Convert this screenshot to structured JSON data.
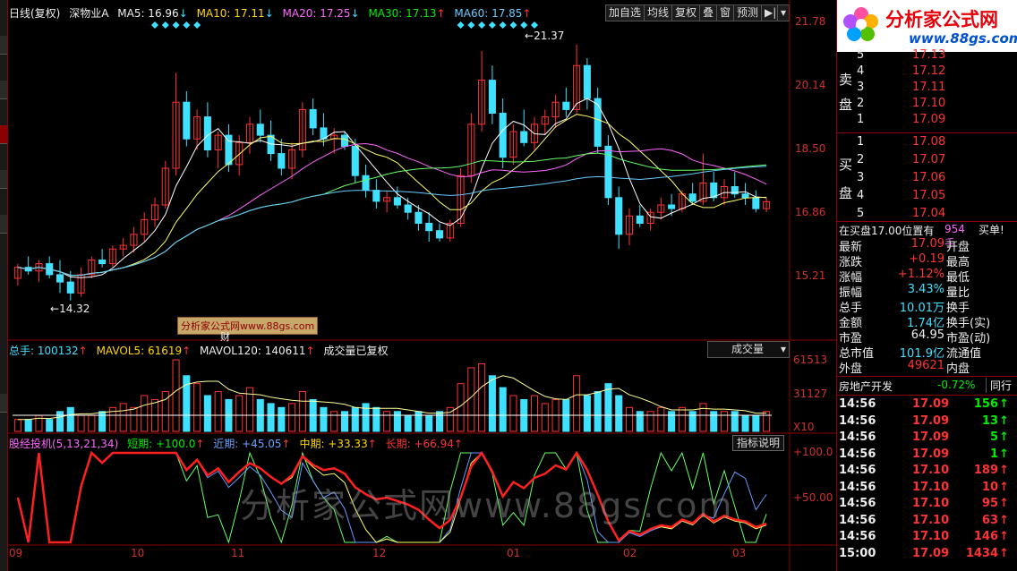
{
  "header": {
    "period": "日线(复权)",
    "stock": "深物业A",
    "ma5": "MA5: 16.96",
    "ma10": "MA10: 17.11",
    "ma20": "MA20: 17.25",
    "ma30": "MA30: 17.13",
    "ma60": "MA60: 17.85"
  },
  "toolbar": [
    "加自选",
    "均线",
    "复权",
    "叠",
    "窗",
    "预测"
  ],
  "price_axis": [
    "21.78",
    "20.14",
    "18.50",
    "16.86",
    "15.21"
  ],
  "annotations": {
    "high": "21.37",
    "low": "14.32",
    "watermark_box": "分析家公式网www.88gs.com",
    "finance_mark": "财"
  },
  "volume": {
    "total": "总手: 100132",
    "mavol5": "MAVOL5: 61619",
    "mavol120": "MAVOL120: 140611",
    "note": "成交量已复权",
    "selector": "成交量",
    "axis": [
      "61513",
      "31127",
      "X10"
    ]
  },
  "indicator": {
    "name": "股经投机(5,13,21,34)",
    "short": "短期: +100.0",
    "near": "近期: +45.05",
    "mid": "中期: +33.33",
    "long": "长期: +66.94",
    "help": "指标说明",
    "axis": [
      "+100.0",
      "+50.00"
    ]
  },
  "x_axis": [
    "09",
    "10",
    "11",
    "12",
    "01",
    "02",
    "03"
  ],
  "watermark": "分析家公式网www.88gs.com",
  "logo": {
    "title": "分析家公式网",
    "url": "www.88gs.com"
  },
  "orderbook": {
    "sell_label_1": "卖",
    "sell_label_2": "盘",
    "buy_label_1": "买",
    "buy_label_2": "盘",
    "sell": [
      {
        "lvl": "5",
        "price": "17.13"
      },
      {
        "lvl": "4",
        "price": "17.12"
      },
      {
        "lvl": "3",
        "price": "17.11"
      },
      {
        "lvl": "2",
        "price": "17.10"
      },
      {
        "lvl": "1",
        "price": "17.09"
      }
    ],
    "buy": [
      {
        "lvl": "1",
        "price": "17.08"
      },
      {
        "lvl": "2",
        "price": "17.07"
      },
      {
        "lvl": "3",
        "price": "17.06"
      },
      {
        "lvl": "4",
        "price": "17.05"
      },
      {
        "lvl": "5",
        "price": "17.04"
      }
    ]
  },
  "position": {
    "text": "在买盘17.00位置有",
    "qty": "954手",
    "action": "买单!"
  },
  "quote": [
    {
      "k": "最新",
      "v": "17.09",
      "k2": "开盘",
      "c": "red"
    },
    {
      "k": "涨跌",
      "v": "+0.19",
      "k2": "最高",
      "c": "red"
    },
    {
      "k": "涨幅",
      "v": "+1.12%",
      "k2": "最低",
      "c": "red"
    },
    {
      "k": "振幅",
      "v": "3.43%",
      "k2": "量比",
      "c": "cyan"
    },
    {
      "k": "总手",
      "v": "10.01万",
      "k2": "换手",
      "c": "cyan"
    },
    {
      "k": "金额",
      "v": "1.74亿",
      "k2": "换手(实)",
      "c": "cyan"
    },
    {
      "k": "市盈",
      "v": "64.95",
      "k2": "市盈(动)",
      "c": "white"
    },
    {
      "k": "总市值",
      "v": "101.9亿",
      "k2": "流通值",
      "c": "cyan"
    },
    {
      "k": "外盘",
      "v": "49621",
      "k2": "内盘",
      "c": "red"
    }
  ],
  "sector": {
    "name": "房地产开发",
    "change": "-0.72%",
    "tab": "同行"
  },
  "trades": [
    {
      "t": "14:56",
      "p": "17.09",
      "q": "156",
      "c": "green"
    },
    {
      "t": "14:56",
      "p": "17.09",
      "q": "13",
      "c": "green"
    },
    {
      "t": "14:56",
      "p": "17.09",
      "q": "5",
      "c": "green"
    },
    {
      "t": "14:56",
      "p": "17.09",
      "q": "1",
      "c": "green"
    },
    {
      "t": "14:56",
      "p": "17.10",
      "q": "189",
      "c": "red"
    },
    {
      "t": "14:56",
      "p": "17.10",
      "q": "10",
      "c": "red"
    },
    {
      "t": "14:56",
      "p": "17.10",
      "q": "95",
      "c": "red"
    },
    {
      "t": "14:56",
      "p": "17.10",
      "q": "63",
      "c": "red"
    },
    {
      "t": "14:56",
      "p": "17.10",
      "q": "146",
      "c": "red"
    },
    {
      "t": "15:00",
      "p": "17.09",
      "q": "1434",
      "c": "red"
    }
  ],
  "colors": {
    "up": "#ff3333",
    "down": "#40e0ff",
    "ma5": "#ffffff",
    "ma10": "#ffff66",
    "ma20": "#ff66ff",
    "ma30": "#66ff66",
    "ma60": "#66ccff",
    "axis": "#8b0000"
  },
  "chart_data": {
    "type": "candlestick",
    "ylim": [
      14.0,
      22.0
    ],
    "candles": [
      [
        15.0,
        15.4,
        14.8,
        15.3
      ],
      [
        15.3,
        15.6,
        15.1,
        15.2
      ],
      [
        15.2,
        15.5,
        14.9,
        15.4
      ],
      [
        15.4,
        15.6,
        15.0,
        15.1
      ],
      [
        15.1,
        15.5,
        14.6,
        14.9
      ],
      [
        14.9,
        15.2,
        14.4,
        14.6
      ],
      [
        14.6,
        15.3,
        14.5,
        15.1
      ],
      [
        15.1,
        15.6,
        15.0,
        15.5
      ],
      [
        15.5,
        15.8,
        15.3,
        15.4
      ],
      [
        15.4,
        15.9,
        15.3,
        15.8
      ],
      [
        15.8,
        16.1,
        15.6,
        15.9
      ],
      [
        15.9,
        16.4,
        15.7,
        16.2
      ],
      [
        16.2,
        16.8,
        16.0,
        16.6
      ],
      [
        16.6,
        17.2,
        16.4,
        17.0
      ],
      [
        17.0,
        18.2,
        16.9,
        18.0
      ],
      [
        18.0,
        20.6,
        17.8,
        19.8
      ],
      [
        19.8,
        20.1,
        18.6,
        18.8
      ],
      [
        18.8,
        19.6,
        18.5,
        19.4
      ],
      [
        19.4,
        19.8,
        18.3,
        18.5
      ],
      [
        18.5,
        19.0,
        18.0,
        18.9
      ],
      [
        18.9,
        19.2,
        17.9,
        18.1
      ],
      [
        18.1,
        18.9,
        17.8,
        18.7
      ],
      [
        18.7,
        19.4,
        18.4,
        19.2
      ],
      [
        19.2,
        19.6,
        18.7,
        18.9
      ],
      [
        18.9,
        19.3,
        18.2,
        18.4
      ],
      [
        18.4,
        18.8,
        17.8,
        18.0
      ],
      [
        18.0,
        18.7,
        17.7,
        18.5
      ],
      [
        18.5,
        19.8,
        18.3,
        19.6
      ],
      [
        19.6,
        19.9,
        18.9,
        19.1
      ],
      [
        19.1,
        19.5,
        18.6,
        18.8
      ],
      [
        18.8,
        19.1,
        18.4,
        18.9
      ],
      [
        18.9,
        19.0,
        18.5,
        18.6
      ],
      [
        18.6,
        18.8,
        17.6,
        17.8
      ],
      [
        17.8,
        18.1,
        17.2,
        17.4
      ],
      [
        17.4,
        17.7,
        16.9,
        17.1
      ],
      [
        17.1,
        17.4,
        16.8,
        17.2
      ],
      [
        17.2,
        17.5,
        16.9,
        17.0
      ],
      [
        17.0,
        17.2,
        16.6,
        16.8
      ],
      [
        16.8,
        17.0,
        16.3,
        16.5
      ],
      [
        16.5,
        16.8,
        16.0,
        16.3
      ],
      [
        16.3,
        16.5,
        16.0,
        16.1
      ],
      [
        16.1,
        16.6,
        16.0,
        16.5
      ],
      [
        16.5,
        18.0,
        16.4,
        17.8
      ],
      [
        17.8,
        19.5,
        17.6,
        19.2
      ],
      [
        19.2,
        21.2,
        19.0,
        20.4
      ],
      [
        20.4,
        20.8,
        19.2,
        19.5
      ],
      [
        19.5,
        19.9,
        18.0,
        18.3
      ],
      [
        18.3,
        19.2,
        18.1,
        19.0
      ],
      [
        19.0,
        19.6,
        18.6,
        18.7
      ],
      [
        18.7,
        19.4,
        18.5,
        19.2
      ],
      [
        19.2,
        19.6,
        18.9,
        19.4
      ],
      [
        19.4,
        20.0,
        19.1,
        19.8
      ],
      [
        19.8,
        20.2,
        19.4,
        19.6
      ],
      [
        19.6,
        21.37,
        19.5,
        20.8
      ],
      [
        20.8,
        21.0,
        19.6,
        19.9
      ],
      [
        19.9,
        20.2,
        18.4,
        18.6
      ],
      [
        18.6,
        18.9,
        17.0,
        17.2
      ],
      [
        17.2,
        17.5,
        15.8,
        16.2
      ],
      [
        16.2,
        16.9,
        15.9,
        16.7
      ],
      [
        16.7,
        17.0,
        16.4,
        16.5
      ],
      [
        16.5,
        16.9,
        16.3,
        16.8
      ],
      [
        16.8,
        17.2,
        16.6,
        17.0
      ],
      [
        17.0,
        17.3,
        16.7,
        16.9
      ],
      [
        16.9,
        17.4,
        16.8,
        17.3
      ],
      [
        17.3,
        17.6,
        17.0,
        17.1
      ],
      [
        17.1,
        18.4,
        17.0,
        17.6
      ],
      [
        17.6,
        17.9,
        17.1,
        17.2
      ],
      [
        17.2,
        17.7,
        17.0,
        17.5
      ],
      [
        17.5,
        17.9,
        17.2,
        17.3
      ],
      [
        17.3,
        17.6,
        17.0,
        17.2
      ],
      [
        17.2,
        17.4,
        16.8,
        16.9
      ],
      [
        16.9,
        17.2,
        16.8,
        17.09
      ]
    ],
    "volume": [
      3,
      3,
      4,
      3,
      5,
      6,
      4,
      4,
      5,
      6,
      7,
      6,
      9,
      8,
      10,
      18,
      14,
      12,
      9,
      10,
      8,
      9,
      11,
      8,
      7,
      6,
      7,
      10,
      8,
      6,
      5,
      5,
      6,
      7,
      6,
      5,
      5,
      4,
      5,
      4,
      5,
      6,
      12,
      16,
      17,
      14,
      11,
      9,
      8,
      9,
      7,
      8,
      8,
      14,
      9,
      10,
      12,
      9,
      6,
      5,
      5,
      6,
      5,
      6,
      5,
      7,
      5,
      5,
      5,
      4,
      4,
      5
    ]
  }
}
